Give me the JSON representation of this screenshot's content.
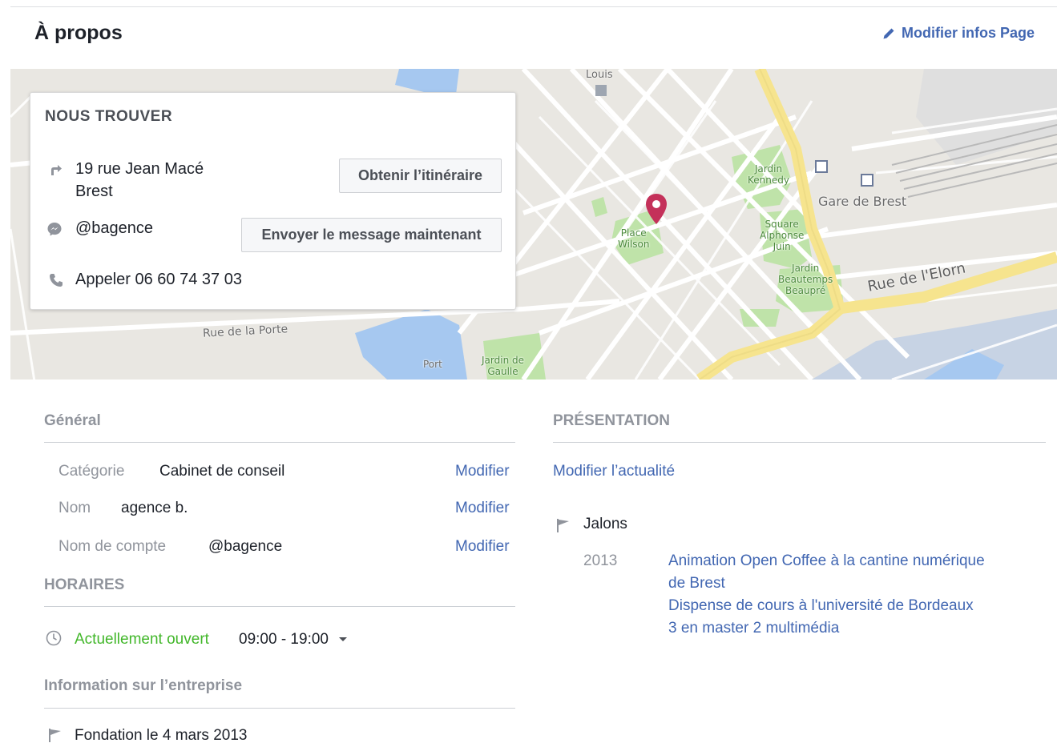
{
  "header": {
    "title": "À propos",
    "edit_label": "Modifier infos Page"
  },
  "map": {
    "labels": {
      "louis": "Louis",
      "jardin_kennedy_1": "Jardin",
      "jardin_kennedy_2": "Kennedy",
      "gare": "Gare de Brest",
      "place_wilson_1": "Place",
      "place_wilson_2": "Wilson",
      "square_1": "Square",
      "square_2": "Alphonse",
      "square_3": "Juin",
      "jardin_b_1": "Jardin",
      "jardin_b_2": "Beautemps",
      "jardin_b_3": "Beaupré",
      "rue_elorn": "Rue de l'Elorn",
      "rue_porte": "Rue de la Porte",
      "port": "Port",
      "jardin_gaulle_1": "Jardin de",
      "jardin_gaulle_2": "Gaulle"
    },
    "pin_color": "#c4315a"
  },
  "find_us": {
    "title": "NOUS TROUVER",
    "address_line1": "19 rue Jean Macé",
    "address_line2": "Brest",
    "directions_button": "Obtenir l’itinéraire",
    "messenger_handle": "@bagence",
    "message_button": "Envoyer le message maintenant",
    "phone": "Appeler 06 60 74 37 03"
  },
  "general": {
    "heading": "Général",
    "rows": [
      {
        "label": "Catégorie",
        "value": "Cabinet de conseil",
        "action": "Modifier"
      },
      {
        "label": "Nom",
        "value": "agence b.",
        "action": "Modifier"
      },
      {
        "label": "Nom de compte",
        "value": "@bagence",
        "action": "Modifier"
      }
    ]
  },
  "hours": {
    "heading": "HORAIRES",
    "status": "Actuellement ouvert",
    "range": "09:00 - 19:00"
  },
  "business_info": {
    "heading": "Information sur l’entreprise",
    "founded": "Fondation le 4 mars 2013"
  },
  "presentation": {
    "heading": "PRÉSENTATION",
    "edit_story": "Modifier l’actualité",
    "milestones_label": "Jalons",
    "year": "2013",
    "milestone_lines": [
      "Animation Open Coffee à la cantine numérique",
      "de Brest",
      "Dispense de cours à l'université de Bordeaux",
      "3 en master 2 multimédia"
    ]
  },
  "colors": {
    "link": "#4267b2",
    "open_green": "#42b72a",
    "muted": "#90949c"
  }
}
